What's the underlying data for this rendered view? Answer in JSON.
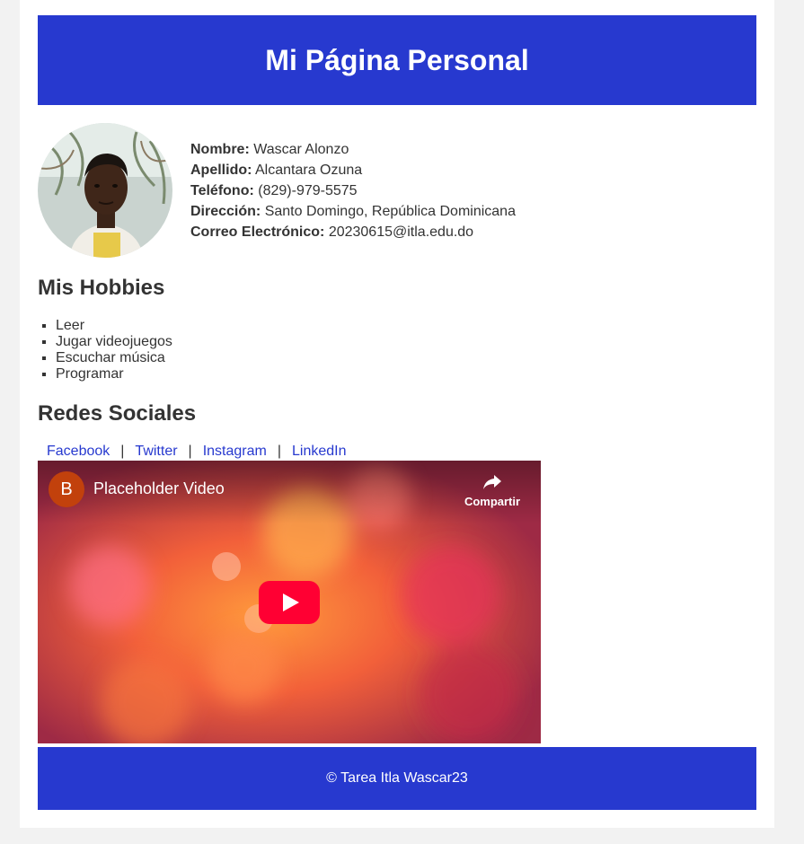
{
  "header": {
    "title": "Mi Página Personal"
  },
  "profile": {
    "fields": [
      {
        "label": "Nombre:",
        "value": "Wascar Alonzo"
      },
      {
        "label": "Apellido:",
        "value": "Alcantara Ozuna"
      },
      {
        "label": "Teléfono:",
        "value": "(829)-979-5575"
      },
      {
        "label": "Dirección:",
        "value": "Santo Domingo, República Dominicana"
      },
      {
        "label": "Correo Electrónico:",
        "value": "20230615@itla.edu.do"
      }
    ]
  },
  "hobbies": {
    "title": "Mis Hobbies",
    "items": [
      "Leer",
      "Jugar videojuegos",
      "Escuchar música",
      "Programar"
    ]
  },
  "social": {
    "title": "Redes Sociales",
    "links": [
      "Facebook",
      "Twitter",
      "Instagram",
      "LinkedIn"
    ],
    "separator": "|"
  },
  "video": {
    "channel_initial": "B",
    "title": "Placeholder Video",
    "share_label": "Compartir"
  },
  "footer": {
    "text": "© Tarea Itla Wascar23"
  },
  "colors": {
    "brand_blue": "#2739cf",
    "link": "#2739cf",
    "play_red": "#ff0033"
  }
}
